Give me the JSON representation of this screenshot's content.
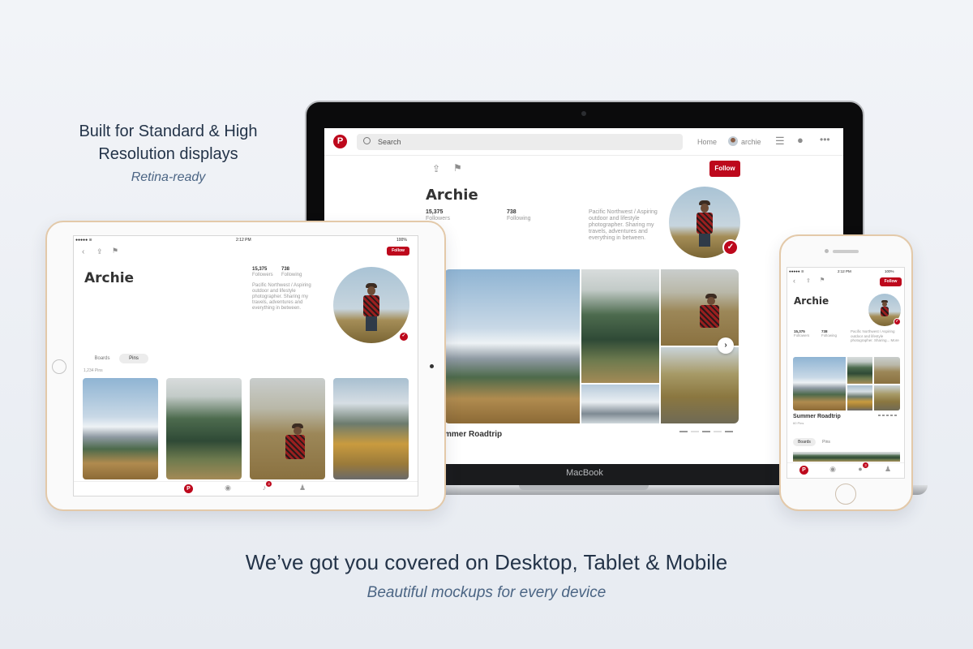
{
  "headline": "Built for Standard & High Resolution displays",
  "subline": "Retina-ready",
  "footer": {
    "title": "We’ve got you covered on Desktop, Tablet & Mobile",
    "subtitle": "Beautiful mockups for every device"
  },
  "colors": {
    "brand": "#bd081c",
    "text_dark": "#243449",
    "text_accent": "#4b6584"
  },
  "laptop": {
    "label": "MacBook",
    "app": {
      "logo": "P",
      "search_placeholder": "Search",
      "nav": {
        "home": "Home",
        "user": "archie"
      },
      "follow": "Follow",
      "profile": {
        "name": "Archie",
        "followers_count": "15,375",
        "followers_label": "Followers",
        "following_count": "738",
        "following_label": "Following",
        "bio": "Pacific Northwest / Aspiring outdoor and lifestyle photographer. Sharing my travels, adventures and everything in between."
      },
      "board_caption": "mmer Roadtrip"
    }
  },
  "tablet": {
    "status_time": "2:12 PM",
    "status_battery": "100%",
    "follow": "Follow",
    "profile": {
      "name": "Archie",
      "followers_count": "15,375",
      "followers_label": "Followers",
      "following_count": "738",
      "following_label": "Following",
      "bio": "Pacific Northwest / Aspiring outdoor and lifestyle photographer. Sharing my travels, adventures and everything in between."
    },
    "tabs": [
      "Boards",
      "Pins"
    ],
    "pins_count": "1,234 Pins",
    "notification_count": "3"
  },
  "phone": {
    "status_time": "2:12 PM",
    "status_battery": "100%",
    "follow": "Follow",
    "profile": {
      "name": "Archie",
      "followers_count": "15,375",
      "followers_label": "Followers",
      "following_count": "738",
      "following_label": "Following",
      "bio": "Pacific Northwest / Aspiring outdoor and lifestyle photographer. Sharing... More"
    },
    "board_title": "Summer Roadtrip",
    "board_pins": "60 Pins",
    "tabs": [
      "Boards",
      "Pins"
    ],
    "notification_count": "3"
  }
}
